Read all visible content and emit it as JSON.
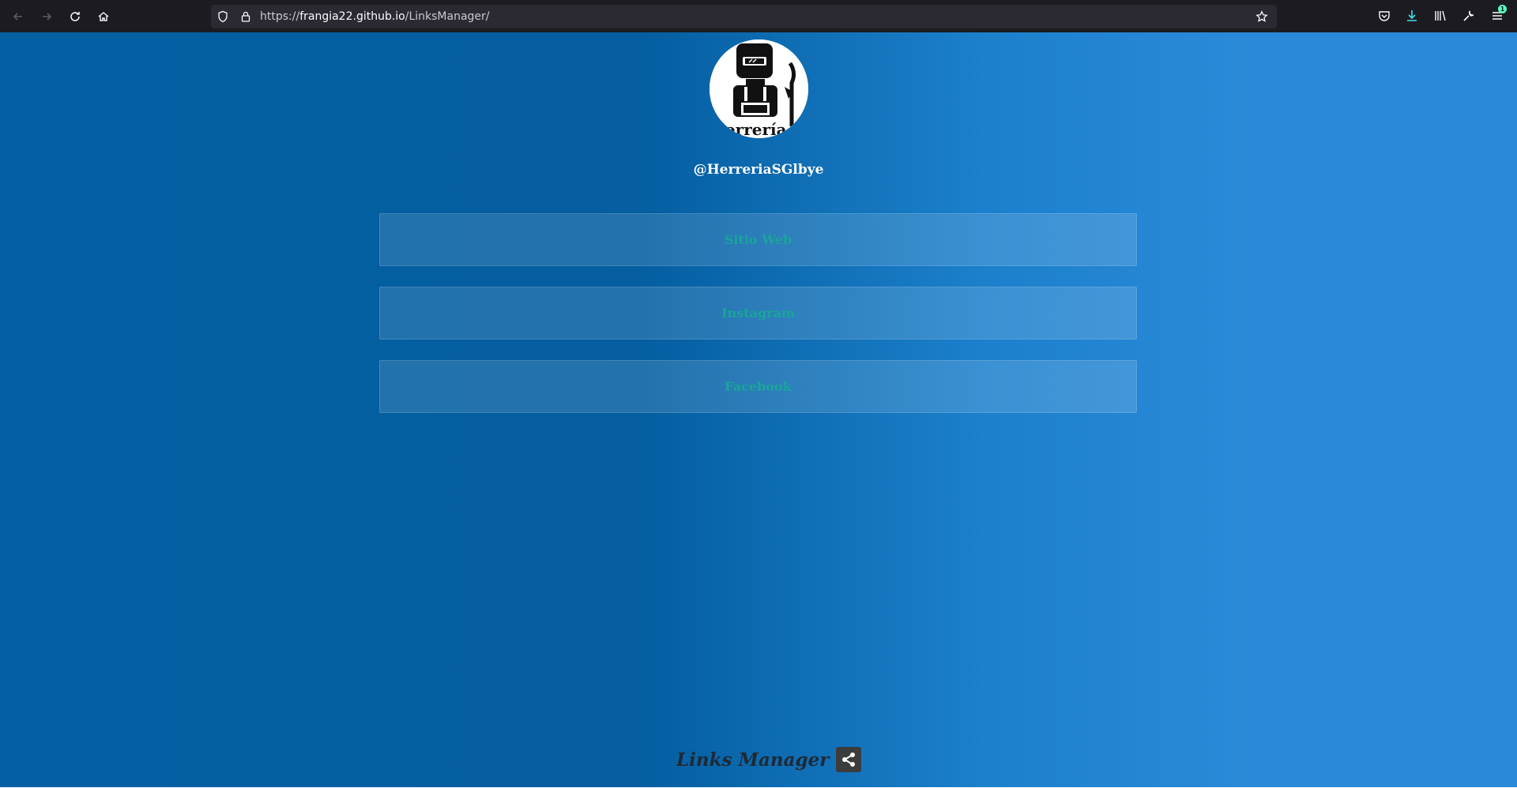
{
  "browser": {
    "url_scheme": "https://",
    "url_host": "frangia22.github.io",
    "url_path": "/LinksManager/",
    "notification_count": "1"
  },
  "profile": {
    "handle": "@HerreriaSGlbye",
    "avatar_caption": "Herrería S"
  },
  "links": [
    {
      "label": "Sitio Web"
    },
    {
      "label": "Instagram"
    },
    {
      "label": "Facebook"
    }
  ],
  "footer": {
    "title": "Links Manager",
    "share_icon": "share-icon"
  },
  "colors": {
    "page_gradient_left": "#0460a2",
    "page_gradient_right": "#2a8ad9",
    "link_text": "#1aa59a",
    "chrome_bg": "#1c1b22"
  }
}
